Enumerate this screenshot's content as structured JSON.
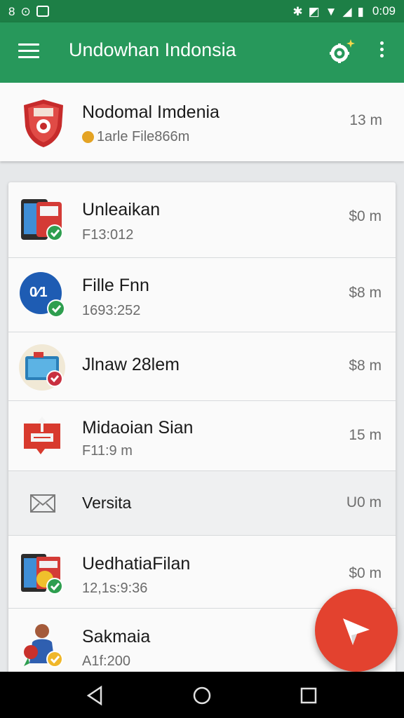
{
  "status_bar": {
    "time": "0:09",
    "left_text": "8"
  },
  "app_bar": {
    "title": "Undowhan Indonsia"
  },
  "header_card": {
    "title": "Nodomal Imdenia",
    "subtitle": "1arle File866m",
    "size": "13 m"
  },
  "list": [
    {
      "title": "Unleaikan",
      "subtitle": "F13:012",
      "size": "$0 m"
    },
    {
      "title": "Fille Fnn",
      "subtitle": "1693:252",
      "size": "$8 m"
    },
    {
      "title": "Jlnaw 28lem",
      "subtitle": "",
      "size": "$8 m"
    },
    {
      "title": "Midaoian Sian",
      "subtitle": "F11:9 m",
      "size": "15 m"
    },
    {
      "title": "Versita",
      "subtitle": "",
      "size": "U0 m"
    },
    {
      "title": "UedhatiaFilan",
      "subtitle": "12,1s:9:36",
      "size": "$0 m"
    },
    {
      "title": "Sakmaia",
      "subtitle": "A1f:200",
      "size": ""
    }
  ],
  "colors": {
    "status_bar": "#1d7f46",
    "app_bar": "#27985b",
    "fab": "#e3422f",
    "check": "#2e9e4f"
  },
  "icons": [
    "menu-icon",
    "settings-icon",
    "more-vert-icon",
    "send-icon",
    "back-icon",
    "home-icon",
    "recents-icon"
  ]
}
